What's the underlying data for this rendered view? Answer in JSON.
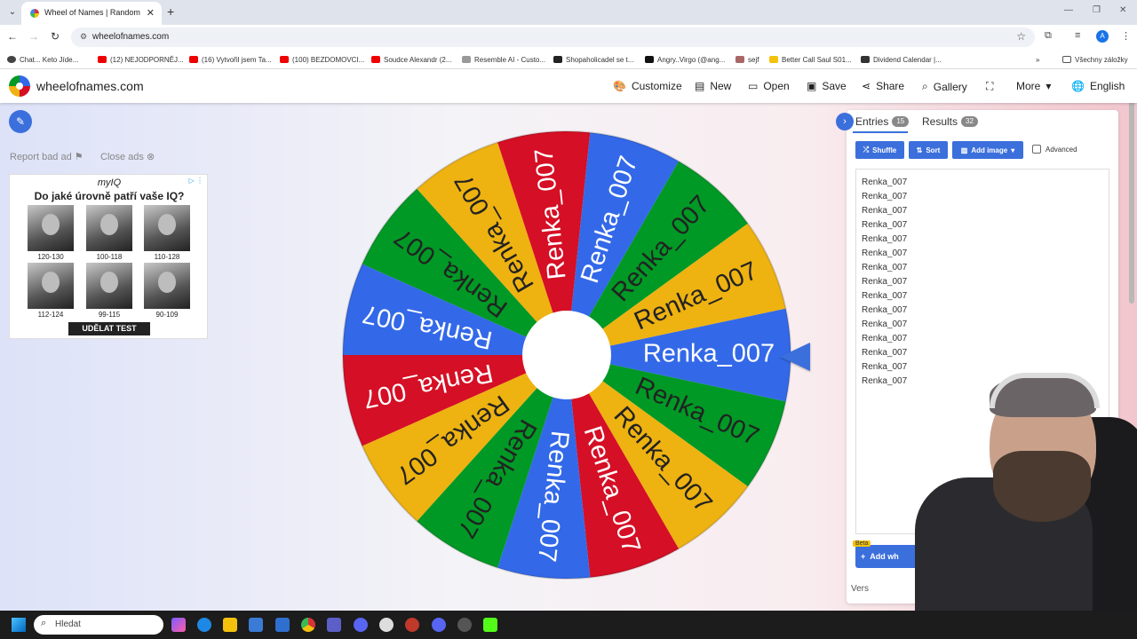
{
  "browser": {
    "tab_title": "Wheel of Names | Random nam",
    "url": "wheelofnames.com",
    "bookmarks": [
      "Chat... Keto Jíde...",
      "(12) NEJODPORNĚJ...",
      "(16) Vytvořil jsem Ta...",
      "(100) BEZDOMOVCI...",
      "Soudce Alexandr (2...",
      "Resemble AI - Custo...",
      "Shopaholicadel se t...",
      "Angry..Virgo (@ang...",
      "sejf",
      "Better Call Saul S01...",
      "Dividend Calendar |..."
    ],
    "all_bookmarks": "Všechny záložky",
    "profile_initial": "A"
  },
  "site": {
    "name": "wheelofnames.com",
    "menu": [
      "Customize",
      "New",
      "Open",
      "Save",
      "Share",
      "Gallery",
      "More",
      "English"
    ]
  },
  "ad": {
    "report": "Report bad ad",
    "close": "Close ads",
    "brand": "myIQ",
    "question": "Do jaké úrovně patří vaše IQ?",
    "ranges": [
      "120-130",
      "100-118",
      "110-128",
      "112-124",
      "99-115",
      "90-109"
    ],
    "cta": "UDĚLAT TEST"
  },
  "wheel": {
    "colors": [
      "#3369e8",
      "#d50f25",
      "#eeb211",
      "#009925"
    ],
    "segment_label": "Renka_007",
    "segment_count": 15
  },
  "panel": {
    "tab_entries": "Entries",
    "entries_count": "15",
    "tab_results": "Results",
    "results_count": "32",
    "shuffle": "Shuffle",
    "sort": "Sort",
    "add_image": "Add image",
    "advanced": "Advanced",
    "entries": [
      "Renka_007",
      "Renka_007",
      "Renka_007",
      "Renka_007",
      "Renka_007",
      "Renka_007",
      "Renka_007",
      "Renka_007",
      "Renka_007",
      "Renka_007",
      "Renka_007",
      "Renka_007",
      "Renka_007",
      "Renka_007",
      "Renka_007"
    ],
    "beta": "Beta",
    "add_wheel": "Add wh",
    "version": "Vers"
  },
  "taskbar": {
    "search_placeholder": "Hledat"
  }
}
